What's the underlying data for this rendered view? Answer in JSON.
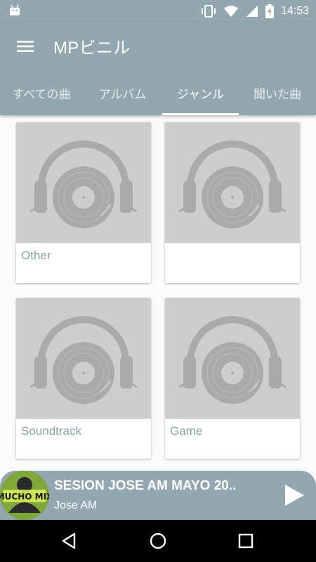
{
  "status_bar": {
    "time": "14:53",
    "icons": [
      "android-icon",
      "vibrate-icon",
      "wifi-icon",
      "cell-signal-icon",
      "battery-charging-icon"
    ]
  },
  "app_bar": {
    "title": "MPビニル",
    "menu_icon": "hamburger-menu-icon"
  },
  "tabs": [
    {
      "label": "すべての曲",
      "active": false
    },
    {
      "label": "アルバム",
      "active": false
    },
    {
      "label": "ジャンル",
      "active": true
    },
    {
      "label": "聞いた曲",
      "active": false
    }
  ],
  "genres": [
    {
      "label": "Other",
      "art_icon": "headphones-vinyl-icon"
    },
    {
      "label": "",
      "art_icon": "headphones-vinyl-icon"
    },
    {
      "label": "Soundtrack",
      "art_icon": "headphones-vinyl-icon"
    },
    {
      "label": "Game",
      "art_icon": "headphones-vinyl-icon"
    }
  ],
  "player": {
    "title": "SESION JOSE AM MAYO 20..",
    "artist": "Jose AM",
    "album_art_text": "MUCHO MIX",
    "play_icon": "play-icon"
  },
  "nav_bar": {
    "icons": [
      "back-icon",
      "home-icon",
      "recents-icon"
    ]
  },
  "colors": {
    "primary": "#93a7b0",
    "card_art_bg": "#cdcdcd",
    "genre_label": "#8aa0ab",
    "nav_bar": "#000000"
  }
}
